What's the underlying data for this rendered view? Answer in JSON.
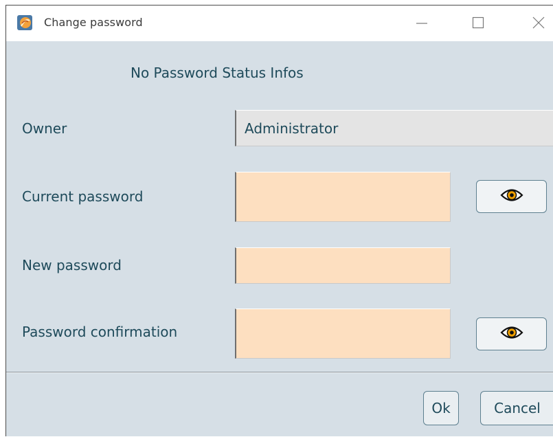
{
  "window": {
    "title": "Change password",
    "icon": "app-logo-icon",
    "controls": [
      "minimize-icon",
      "maximize-icon",
      "close-icon"
    ]
  },
  "status": {
    "text": "No Password Status Infos"
  },
  "form": {
    "owner": {
      "label": "Owner",
      "value": "Administrator"
    },
    "current_password": {
      "label": "Current password",
      "value": ""
    },
    "new_password": {
      "label": "New password",
      "value": ""
    },
    "password_confirmation": {
      "label": "Password confirmation",
      "value": ""
    },
    "show_password_icon": "eye-icon"
  },
  "footer": {
    "ok_label": "Ok",
    "cancel_label": "Cancel"
  },
  "colors": {
    "background": "#d6dfe6",
    "text": "#1e4a5a",
    "password_field": "#fddfc0",
    "readonly_field": "#e4e4e4",
    "eye_accent": "#f0a000"
  }
}
